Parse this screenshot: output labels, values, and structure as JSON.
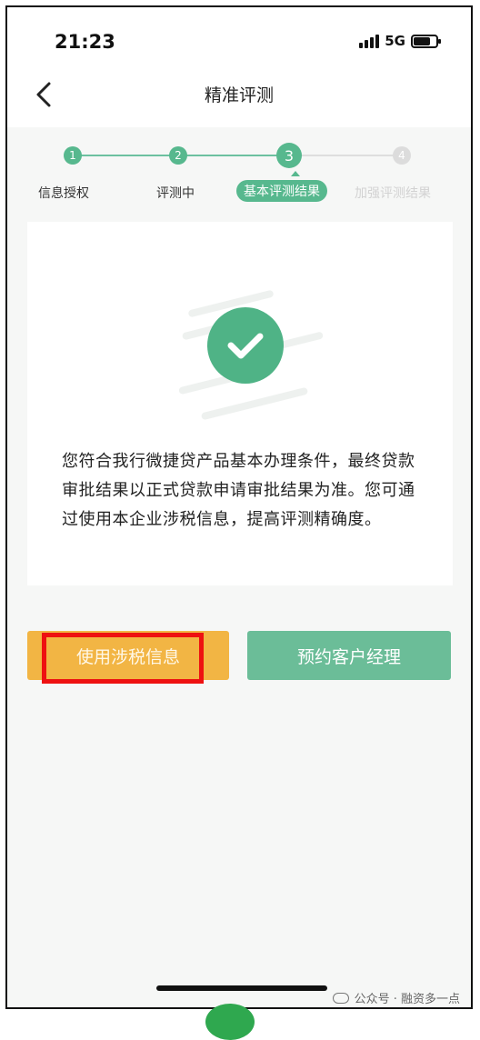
{
  "status_bar": {
    "time": "21:23",
    "network": "5G"
  },
  "nav": {
    "title": "精准评测"
  },
  "steps": [
    {
      "number": "1",
      "label": "信息授权",
      "state": "done"
    },
    {
      "number": "2",
      "label": "评测中",
      "state": "done"
    },
    {
      "number": "3",
      "label": "基本评测结果",
      "state": "active"
    },
    {
      "number": "4",
      "label": "加强评测结果",
      "state": "pending"
    }
  ],
  "result": {
    "icon": "check-circle-icon",
    "message": "您符合我行微捷贷产品基本办理条件，最终贷款审批结果以正式贷款申请审批结果为准。您可通过使用本企业涉税信息，提高评测精确度。"
  },
  "buttons": {
    "use_tax_info": "使用涉税信息",
    "book_manager": "预约客户经理"
  },
  "watermark": "公众号 · 融资多一点",
  "colors": {
    "accent_green": "#57b88e",
    "orange": "#f2b544",
    "highlight_red": "#ee1111"
  }
}
